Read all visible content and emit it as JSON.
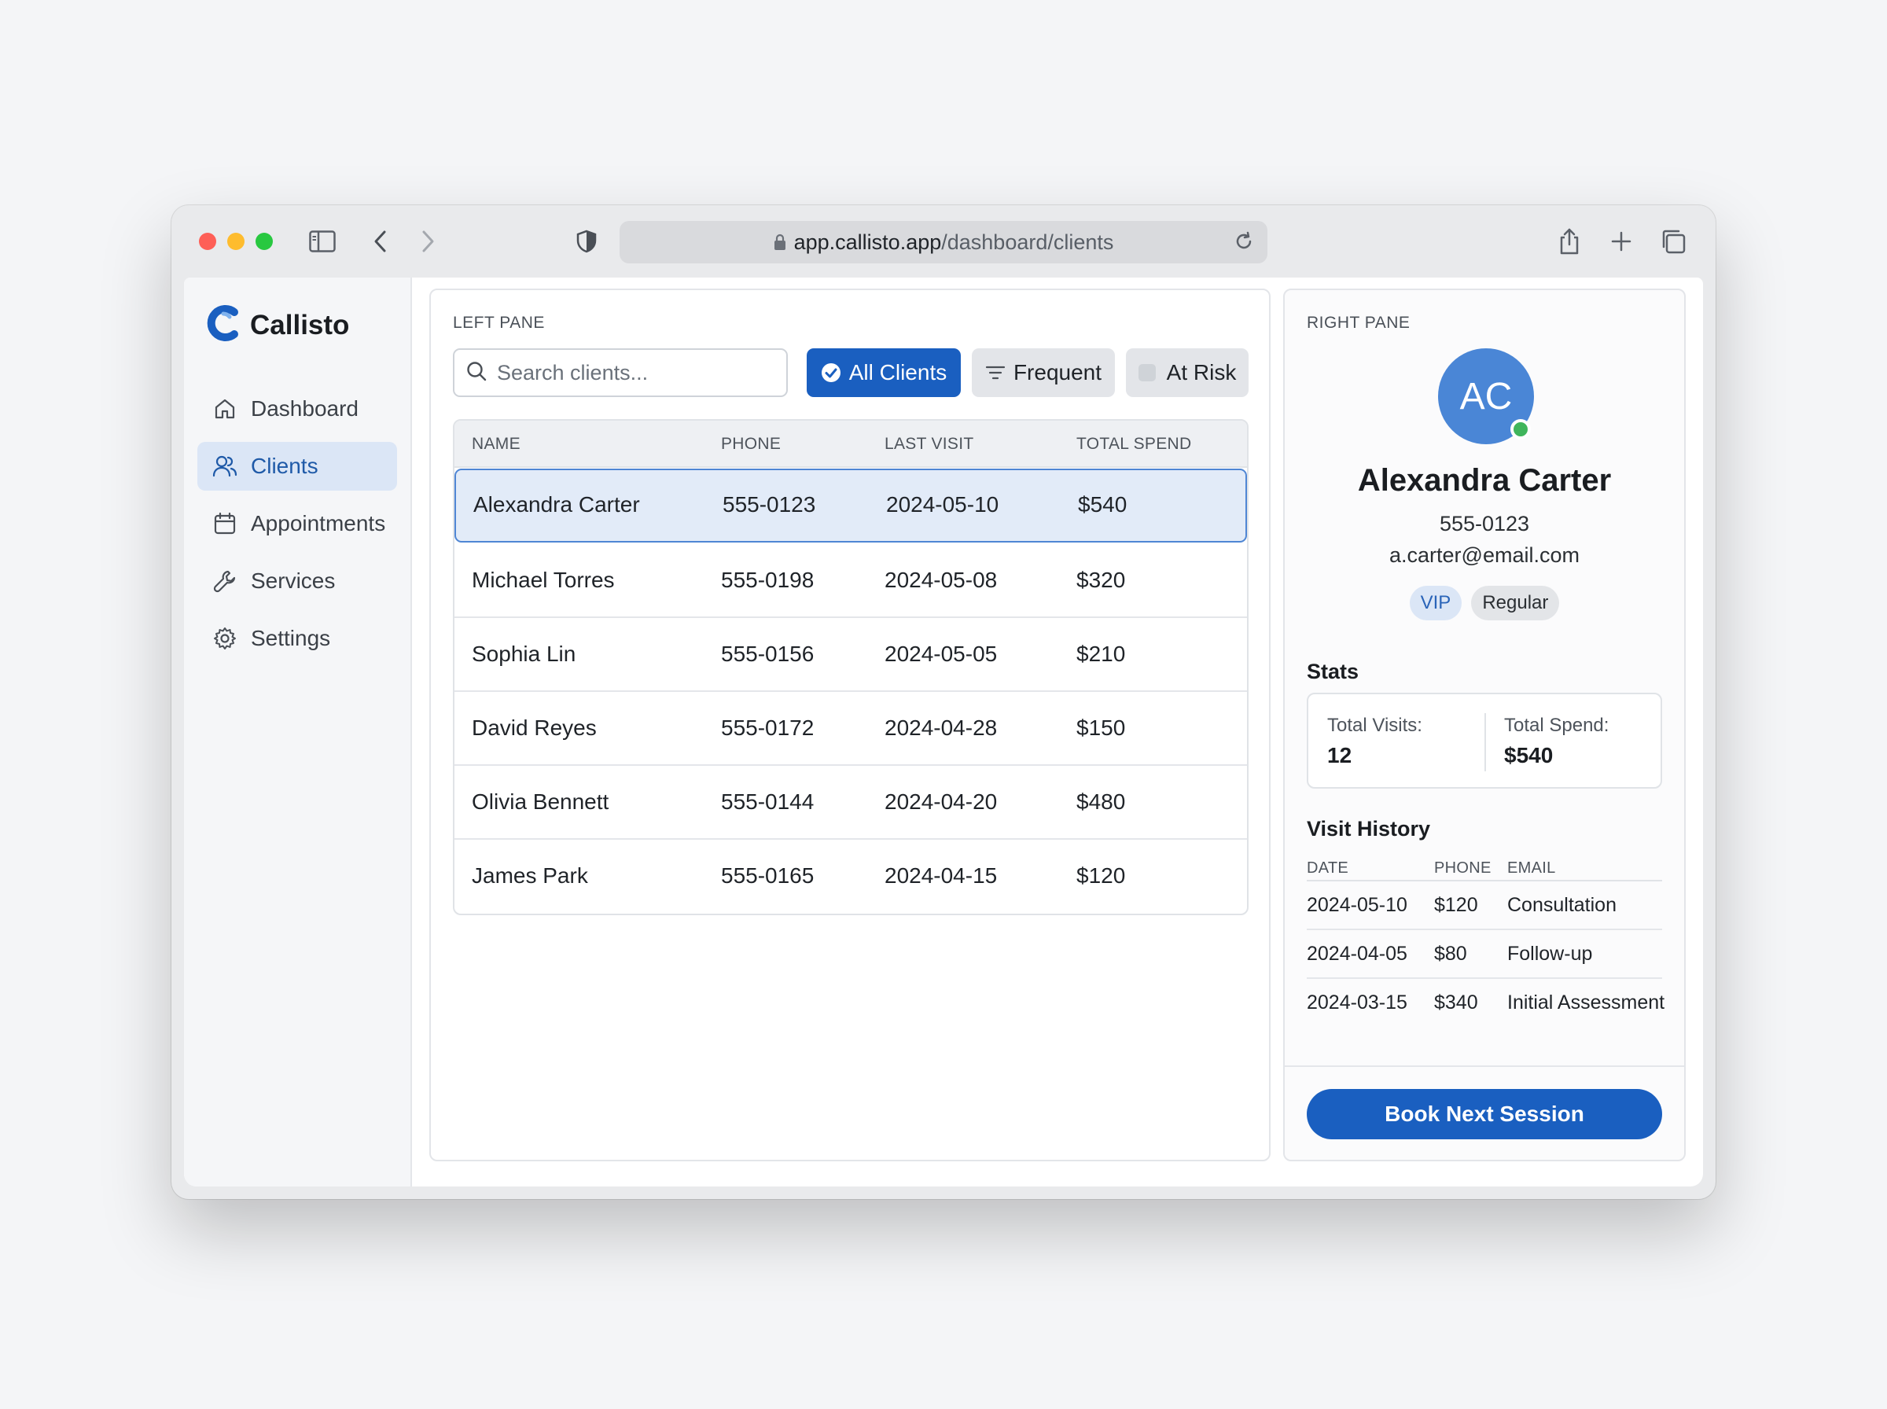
{
  "browser": {
    "url_host": "app.callisto.app",
    "url_path": "/dashboard/clients"
  },
  "brand": {
    "name": "Callisto",
    "accent": "#1a5fc0"
  },
  "sidebar": {
    "items": [
      {
        "label": "Dashboard",
        "icon": "home-icon"
      },
      {
        "label": "Clients",
        "icon": "users-icon",
        "active": true
      },
      {
        "label": "Appointments",
        "icon": "calendar-icon"
      },
      {
        "label": "Services",
        "icon": "wrench-icon"
      },
      {
        "label": "Settings",
        "icon": "gear-icon"
      }
    ]
  },
  "left_pane": {
    "label": "LEFT PANE",
    "search_placeholder": "Search clients...",
    "filters": {
      "all": "All Clients",
      "frequent": "Frequent",
      "at_risk": "At Risk"
    },
    "columns": [
      "NAME",
      "PHONE",
      "LAST VISIT",
      "TOTAL SPEND"
    ],
    "rows": [
      {
        "name": "Alexandra Carter",
        "phone": "555-0123",
        "last_visit": "2024-05-10",
        "total_spend": "$540"
      },
      {
        "name": "Michael Torres",
        "phone": "555-0198",
        "last_visit": "2024-05-08",
        "total_spend": "$320"
      },
      {
        "name": "Sophia Lin",
        "phone": "555-0156",
        "last_visit": "2024-05-05",
        "total_spend": "$210"
      },
      {
        "name": "David Reyes",
        "phone": "555-0172",
        "last_visit": "2024-04-28",
        "total_spend": "$150"
      },
      {
        "name": "Olivia Bennett",
        "phone": "555-0144",
        "last_visit": "2024-04-20",
        "total_spend": "$480"
      },
      {
        "name": "James Park",
        "phone": "555-0165",
        "last_visit": "2024-04-15",
        "total_spend": "$120"
      }
    ]
  },
  "right_pane": {
    "label": "RIGHT PANE",
    "initials": "AC",
    "name": "Alexandra Carter",
    "phone": "555-0123",
    "email": "a.carter@email.com",
    "tags": [
      "VIP",
      "Regular"
    ],
    "stats_title": "Stats",
    "stats": {
      "visits_label": "Total Visits:",
      "visits_value": "12",
      "spend_label": "Total Spend:",
      "spend_value": "$540"
    },
    "history_title": "Visit History",
    "history_columns": [
      "DATE",
      "PHONE",
      "EMAIL"
    ],
    "history": [
      {
        "date": "2024-05-10",
        "amount": "$120",
        "service": "Consultation"
      },
      {
        "date": "2024-04-05",
        "amount": "$80",
        "service": "Follow-up"
      },
      {
        "date": "2024-03-15",
        "amount": "$340",
        "service": "Initial Assessment"
      }
    ],
    "cta": "Book Next Session"
  }
}
